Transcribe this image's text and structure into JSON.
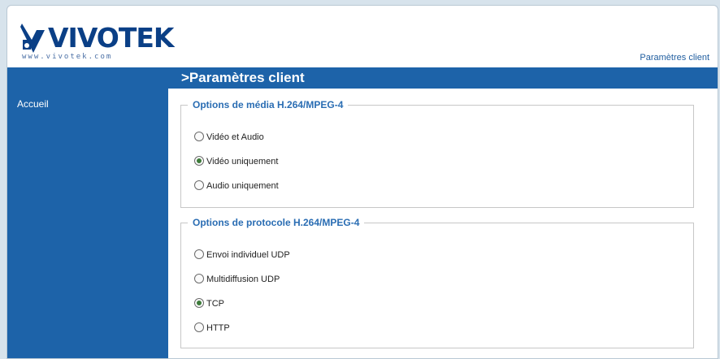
{
  "brand": {
    "name": "VIVOTEK",
    "url": "www.vivotek.com"
  },
  "header": {
    "link_label": "Paramètres client"
  },
  "sidebar": {
    "items": [
      {
        "label": "Accueil"
      }
    ]
  },
  "page": {
    "title": ">Paramètres client"
  },
  "media_options": {
    "legend": "Options de média H.264/MPEG-4",
    "options": [
      {
        "label": "Vidéo et Audio",
        "selected": false
      },
      {
        "label": "Vidéo uniquement",
        "selected": true
      },
      {
        "label": "Audio uniquement",
        "selected": false
      }
    ]
  },
  "protocol_options": {
    "legend": "Options de protocole H.264/MPEG-4",
    "options": [
      {
        "label": "Envoi individuel UDP",
        "selected": false
      },
      {
        "label": "Multidiffusion UDP",
        "selected": false
      },
      {
        "label": "TCP",
        "selected": true
      },
      {
        "label": "HTTP",
        "selected": false
      }
    ]
  },
  "colors": {
    "primary": "#1d63a9",
    "legend": "#2a6db3",
    "brand": "#0a3f86"
  }
}
